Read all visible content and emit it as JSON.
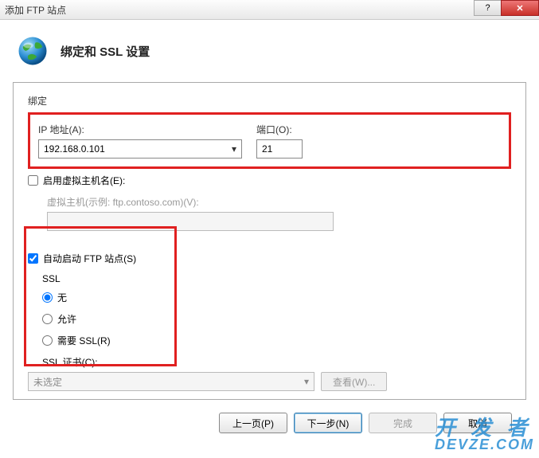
{
  "window": {
    "title": "添加 FTP 站点",
    "help_symbol": "?",
    "close_symbol": "✕"
  },
  "header": {
    "title": "绑定和 SSL 设置"
  },
  "binding": {
    "group_label": "绑定",
    "ip_label": "IP 地址(A):",
    "ip_value": "192.168.0.101",
    "port_label": "端口(O):",
    "port_value": "21"
  },
  "virtual_host": {
    "checkbox_label": "启用虚拟主机名(E):",
    "checked": false,
    "hint_label": "虚拟主机(示例: ftp.contoso.com)(V):",
    "value": ""
  },
  "autostart": {
    "label": "自动启动 FTP 站点(S)",
    "checked": true
  },
  "ssl": {
    "group_label": "SSL",
    "options": {
      "none": "无",
      "allow": "允许",
      "require": "需要 SSL(R)"
    },
    "selected": "none",
    "cert_label": "SSL 证书(C):",
    "cert_value": "未选定",
    "view_button": "查看(W)..."
  },
  "footer": {
    "prev": "上一页(P)",
    "next": "下一步(N)",
    "finish": "完成",
    "cancel": "取消"
  },
  "watermark": {
    "line1": "开 发 者",
    "line2": "DEVZE.COM"
  }
}
